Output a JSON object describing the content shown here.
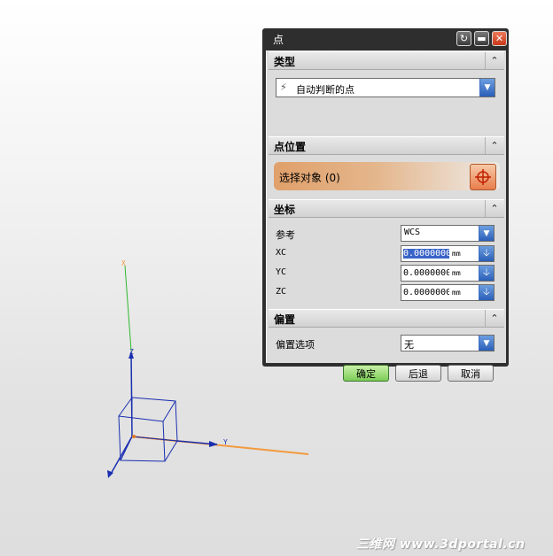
{
  "dialog": {
    "title": "点",
    "sections": {
      "type": {
        "label": "类型",
        "combo_value": "自动判断的点"
      },
      "point_location": {
        "label": "点位置",
        "select_label": "选择对象 (0)"
      },
      "coordinates": {
        "label": "坐标",
        "reference_label": "参考",
        "reference_value": "WCS",
        "fields": [
          {
            "label": "XC",
            "value": "0.0000000",
            "unit": "mm"
          },
          {
            "label": "YC",
            "value": "0.0000000",
            "unit": "mm"
          },
          {
            "label": "ZC",
            "value": "0.0000000",
            "unit": "mm"
          }
        ]
      },
      "offset": {
        "label": "偏置",
        "option_label": "偏置选项",
        "option_value": "无"
      }
    },
    "buttons": {
      "ok": "确定",
      "back": "后退",
      "cancel": "取消"
    }
  },
  "viewport": {
    "axis_labels": {
      "x": "X",
      "y": "Y",
      "z": "Z"
    },
    "watermark": "三维网 www.3dportal.cn"
  },
  "colors": {
    "title_bar": "#2e2e2e",
    "panel": "#dcdcdc",
    "select_highlight": "#e0a06a",
    "ok_button": "#7ccc56",
    "combo_arrow": "#2a5fb8",
    "y_axis": "#f39a3e",
    "z_axis": "#1a2fb0",
    "green_axis": "#2fb82f"
  }
}
